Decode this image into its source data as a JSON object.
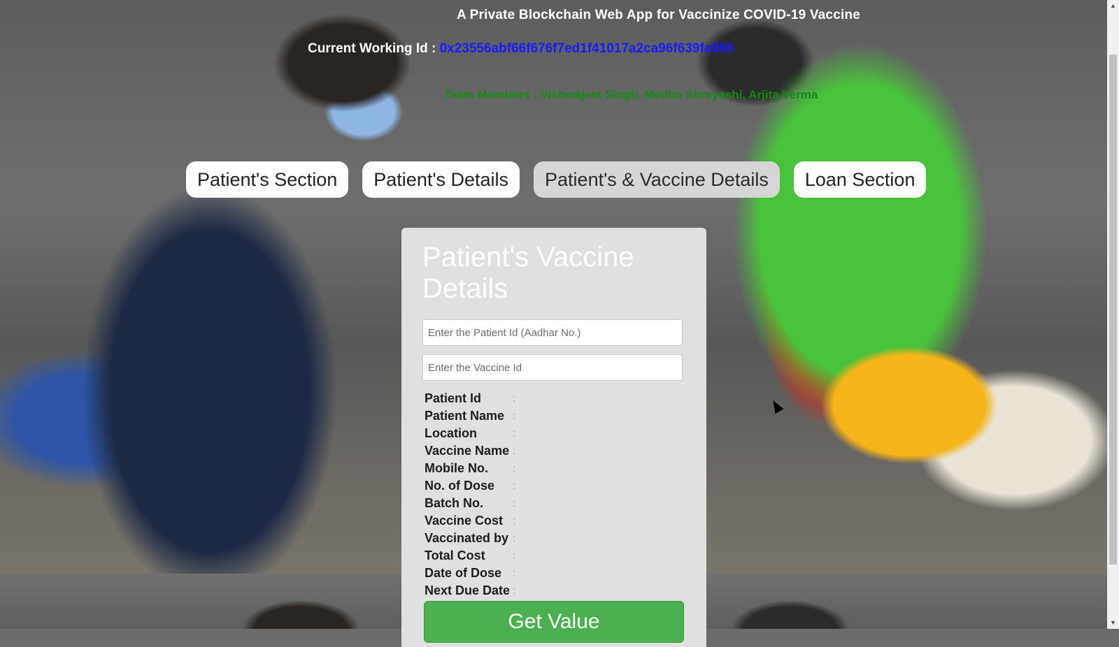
{
  "header": {
    "title": "A Private Blockchain Web App for Vaccinize COVID-19 Vaccine",
    "working_id_label": "Current Working Id : ",
    "working_id_value": "0x23556abf66f676f7ed1f41017a2ca96f639fa986",
    "team": "Team Members : Vishwajeet Singh, Medha Shreyashi, Arjita Verma"
  },
  "nav": {
    "items": [
      {
        "label": "Patient's Section"
      },
      {
        "label": "Patient's Details"
      },
      {
        "label": "Patient's & Vaccine Details"
      },
      {
        "label": "Loan Section"
      }
    ],
    "active_index": 2
  },
  "form": {
    "title": "Patient's Vaccine Details",
    "patient_id_placeholder": "Enter the Patient Id (Aadhar No.)",
    "vaccine_id_placeholder": "Enter the Vaccine Id",
    "fields": [
      {
        "label": "Patient Id",
        "colon": ":",
        "value": ""
      },
      {
        "label": "Patient Name",
        "colon": ":",
        "value": ""
      },
      {
        "label": "Location",
        "colon": ":",
        "value": ""
      },
      {
        "label": "Vaccine Name",
        "colon": ":",
        "value": ""
      },
      {
        "label": "Mobile No.",
        "colon": ":",
        "value": ""
      },
      {
        "label": "No. of Dose",
        "colon": ":",
        "value": ""
      },
      {
        "label": "Batch No.",
        "colon": ":",
        "value": ""
      },
      {
        "label": "Vaccine Cost",
        "colon": ":",
        "value": ""
      },
      {
        "label": "Vaccinated by",
        "colon": ":",
        "value": ""
      },
      {
        "label": "Total Cost",
        "colon": ":",
        "value": ""
      },
      {
        "label": "Date of Dose",
        "colon": ":",
        "value": ""
      },
      {
        "label": "Next Due Date",
        "colon": ":",
        "value": ""
      }
    ],
    "submit_label": "Get Value"
  },
  "colors": {
    "working_id": "#1a1aff",
    "team": "#138a13",
    "button": "#4caf50",
    "card": "#e0dfe1"
  },
  "icons": {
    "scroll_up": "scroll-up-arrow-icon",
    "scroll_down": "scroll-down-arrow-icon",
    "cursor": "mouse-pointer-icon"
  }
}
